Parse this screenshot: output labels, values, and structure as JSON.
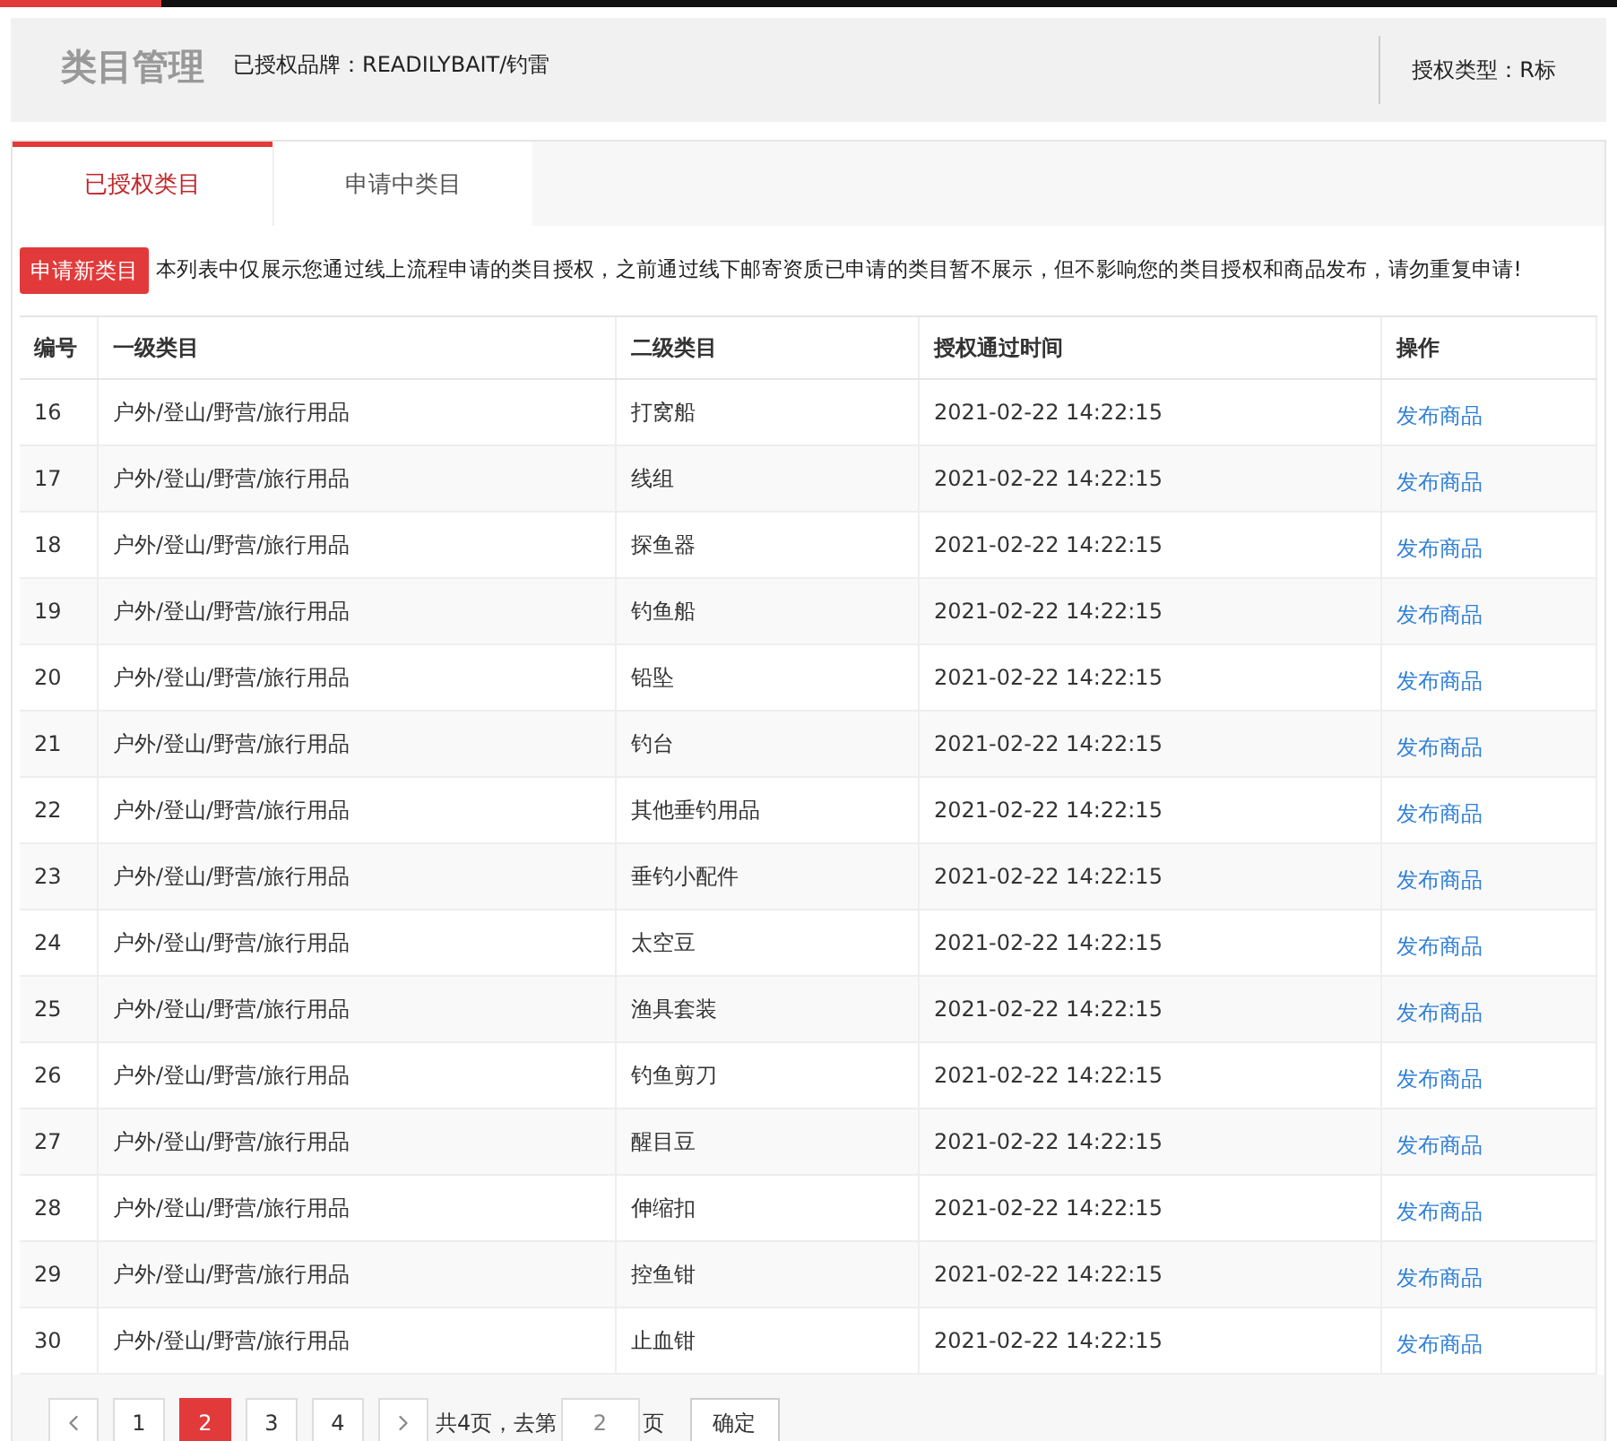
{
  "header": {
    "title": "类目管理",
    "brand": "已授权品牌：READILYBAIT/钓雷",
    "auth_type": "授权类型：R标"
  },
  "tabs": [
    {
      "label": "已授权类目",
      "selected": true
    },
    {
      "label": "申请中类目",
      "selected": false
    }
  ],
  "apply_button": "申请新类目",
  "notice": "本列表中仅展示您通过线上流程申请的类目授权，之前通过线下邮寄资质已申请的类目暂不展示，但不影响您的类目授权和商品发布，请勿重复申请!",
  "table": {
    "columns": [
      "编号",
      "一级类目",
      "二级类目",
      "授权通过时间",
      "操作"
    ],
    "rows": [
      [
        "16",
        "户外/登山/野营/旅行用品",
        "打窝船",
        "2021-02-22 14:22:15",
        "发布商品"
      ],
      [
        "17",
        "户外/登山/野营/旅行用品",
        "线组",
        "2021-02-22 14:22:15",
        "发布商品"
      ],
      [
        "18",
        "户外/登山/野营/旅行用品",
        "探鱼器",
        "2021-02-22 14:22:15",
        "发布商品"
      ],
      [
        "19",
        "户外/登山/野营/旅行用品",
        "钓鱼船",
        "2021-02-22 14:22:15",
        "发布商品"
      ],
      [
        "20",
        "户外/登山/野营/旅行用品",
        "铅坠",
        "2021-02-22 14:22:15",
        "发布商品"
      ],
      [
        "21",
        "户外/登山/野营/旅行用品",
        "钓台",
        "2021-02-22 14:22:15",
        "发布商品"
      ],
      [
        "22",
        "户外/登山/野营/旅行用品",
        "其他垂钓用品",
        "2021-02-22 14:22:15",
        "发布商品"
      ],
      [
        "23",
        "户外/登山/野营/旅行用品",
        "垂钓小配件",
        "2021-02-22 14:22:15",
        "发布商品"
      ],
      [
        "24",
        "户外/登山/野营/旅行用品",
        "太空豆",
        "2021-02-22 14:22:15",
        "发布商品"
      ],
      [
        "25",
        "户外/登山/野营/旅行用品",
        "渔具套装",
        "2021-02-22 14:22:15",
        "发布商品"
      ],
      [
        "26",
        "户外/登山/野营/旅行用品",
        "钓鱼剪刀",
        "2021-02-22 14:22:15",
        "发布商品"
      ],
      [
        "27",
        "户外/登山/野营/旅行用品",
        "醒目豆",
        "2021-02-22 14:22:15",
        "发布商品"
      ],
      [
        "28",
        "户外/登山/野营/旅行用品",
        "伸缩扣",
        "2021-02-22 14:22:15",
        "发布商品"
      ],
      [
        "29",
        "户外/登山/野营/旅行用品",
        "控鱼钳",
        "2021-02-22 14:22:15",
        "发布商品"
      ],
      [
        "30",
        "户外/登山/野营/旅行用品",
        "止血钳",
        "2021-02-22 14:22:15",
        "发布商品"
      ]
    ]
  },
  "pagination": {
    "pages": [
      {
        "label": "1",
        "selected": false
      },
      {
        "label": "2",
        "selected": true
      },
      {
        "label": "3",
        "selected": false
      },
      {
        "label": "4",
        "selected": false
      }
    ],
    "total_text": "共4页，去第",
    "page_input": "2",
    "page_suffix": "页",
    "confirm": "确定"
  }
}
